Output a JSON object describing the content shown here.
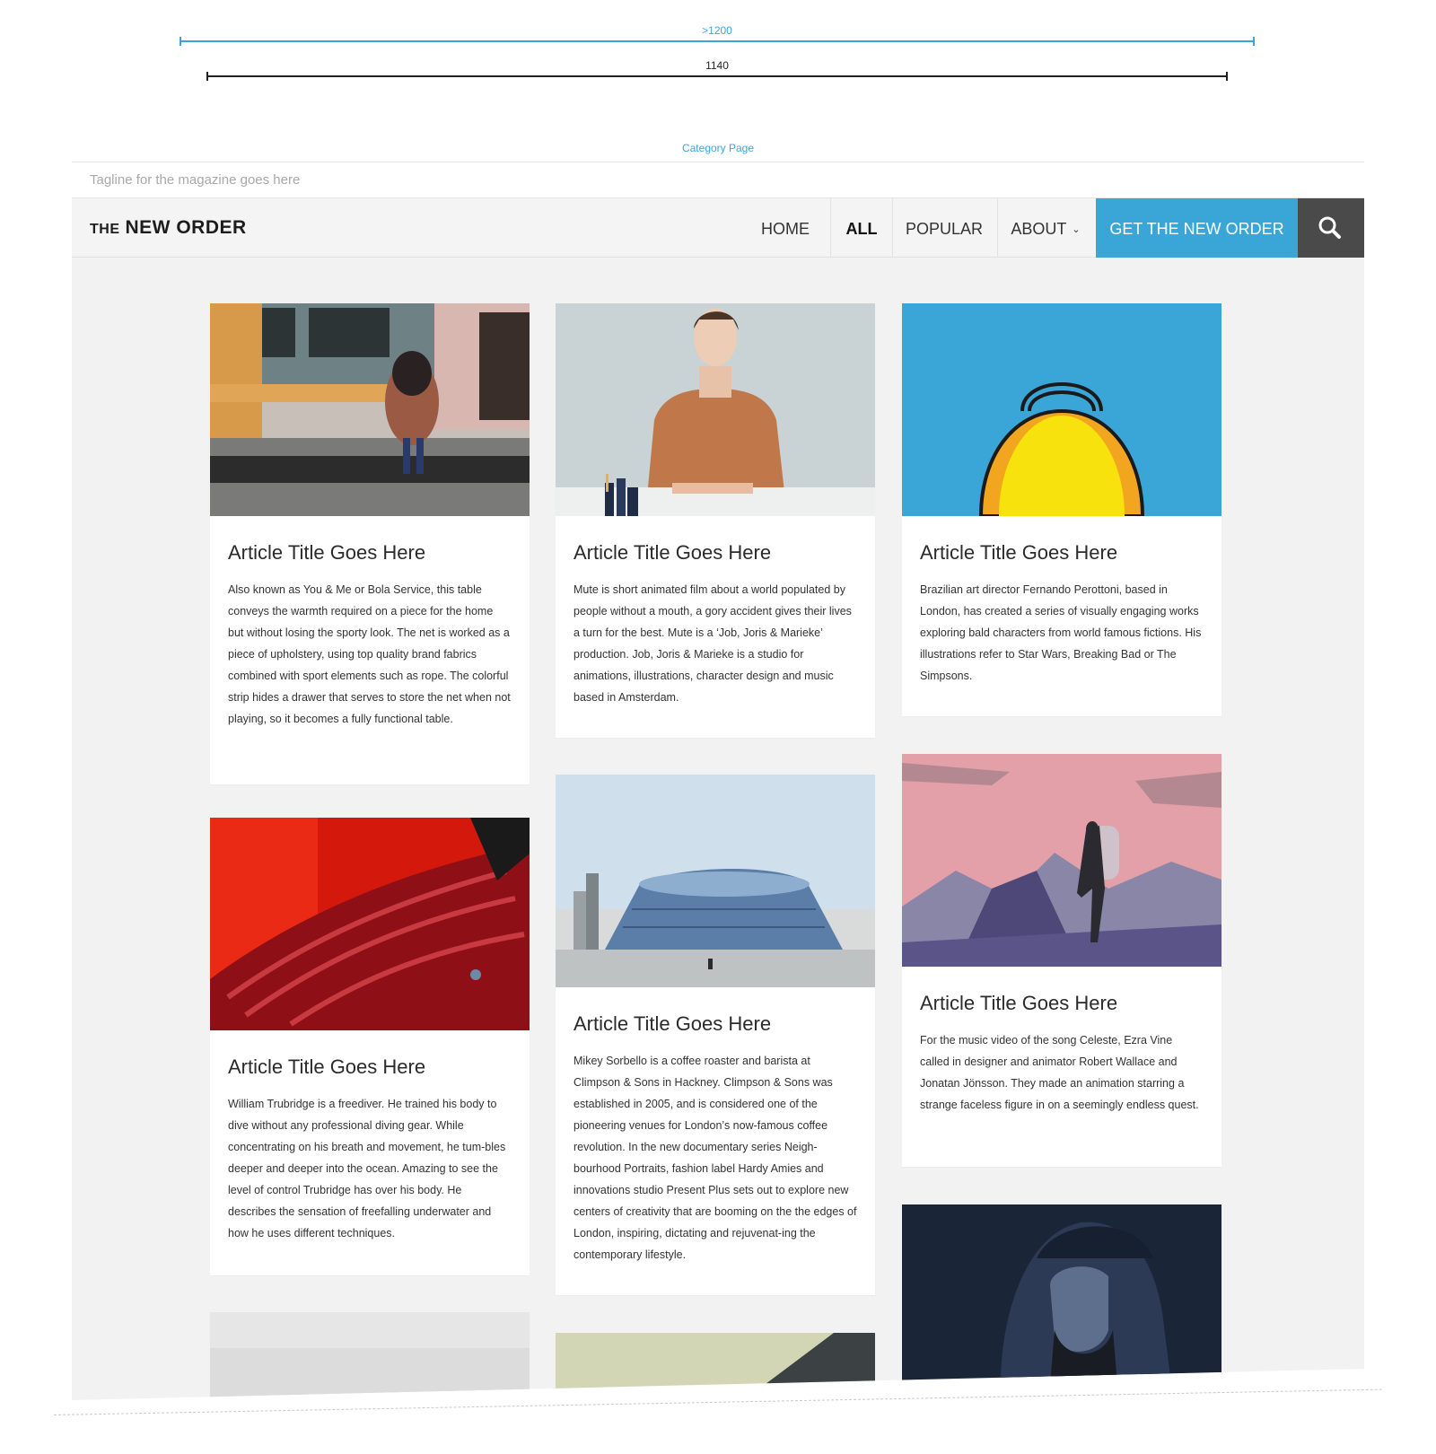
{
  "annotations": {
    "outer_width_label": ">1200",
    "inner_width_label": "1140",
    "page_label": "Category Page"
  },
  "tagline": "Tagline for the magazine goes here",
  "brand": {
    "the": "THE",
    "name": "NEW ORDER"
  },
  "nav": {
    "home": "HOME",
    "all": "ALL",
    "popular": "POPULAR",
    "about": "ABOUT",
    "cta": "GET THE NEW ORDER"
  },
  "colors": {
    "accent": "#3aa6d8",
    "search_bg": "#4a4a4a",
    "page_bg": "#f2f2f2"
  },
  "articles": [
    {
      "title": "Article Title Goes Here",
      "excerpt": "Also known as You & Me or Bola Service, this table conveys the warmth required on a piece for the home but without losing the sporty look. The net is worked as a piece of upholstery, using top quality brand fabrics combined with sport elements such as rope. The colorful strip hides a drawer that serves to store the net when not playing, so it becomes a fully functional table."
    },
    {
      "title": "Article Title Goes Here",
      "excerpt": "Mute is short animated film about a world populated by people without a mouth, a gory accident gives their lives a turn for the best. Mute is a ‘Job, Joris & Marieke’ production. Job, Joris & Marieke is a studio for animations, illustrations, character design and music based in Amsterdam."
    },
    {
      "title": "Article Title Goes Here",
      "excerpt": "Brazilian art director Fernando Perottoni, based in London, has created a series of visually engaging works exploring bald characters from world famous fictions. His illustrations refer to Star Wars, Breaking Bad or The Simpsons."
    },
    {
      "title": "Article Title Goes Here",
      "excerpt": "William Trubridge is a freediver. He trained his body to dive without any professional diving gear. While concentrating on his breath and movement, he tum-bles deeper and deeper into the ocean. Amazing to see the level of control Trubridge has over his body. He describes the sensation of freefalling underwater and how he uses different techniques."
    },
    {
      "title": "Article Title Goes Here",
      "excerpt": "Mikey Sorbello is a coffee roaster and barista at Climpson & Sons in Hackney. Climpson & Sons was established in 2005, and is considered one of the pioneering venues for London’s now-famous coffee revolution. In the new documentary series Neigh-bourhood Portraits, fashion label Hardy Amies and innovations studio Present Plus sets out to explore new centers of creativity that are booming on the the edges of London, inspiring, dictating and rejuvenat-ing the contemporary lifestyle."
    },
    {
      "title": "Article Title Goes Here",
      "excerpt": "For the music video of the song Celeste, Ezra Vine called in designer and animator Robert Wallace and Jonatan Jönsson. They made an animation starring a strange faceless figure in on a seemingly endless quest."
    }
  ]
}
